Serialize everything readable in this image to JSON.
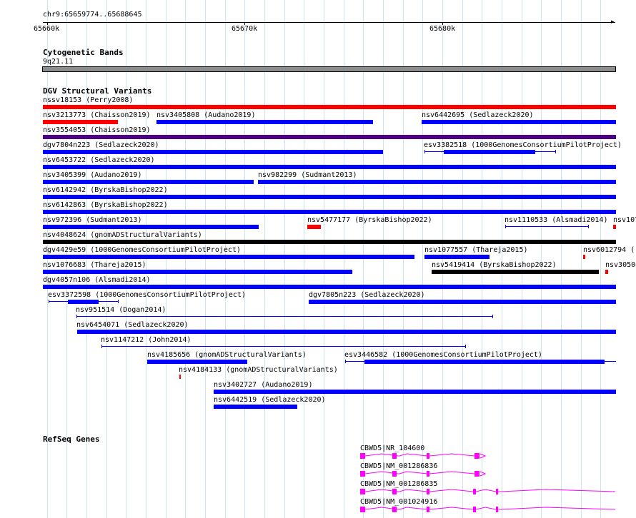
{
  "ruler": {
    "coordinates": "chr9:65659774..65688645",
    "ticks": [
      "65660k",
      "65670k",
      "65680k"
    ]
  },
  "cytoband": {
    "title": "Cytogenetic Bands",
    "band": "9q21.11"
  },
  "dgv": {
    "title": "DGV Structural Variants",
    "variants": [
      "nssv18153 (Perry2008)",
      "nsv3213773 (Chaisson2019)",
      "nsv3405808 (Audano2019)",
      "nsv6442695 (Sedlazeck2020)",
      "nsv3554053 (Chaisson2019)",
      "dgv7804n223 (Sedlazeck2020)",
      "esv3382518 (1000GenomesConsortiumPilotProject)",
      "nsv6453722 (Sedlazeck2020)",
      "nsv3405399 (Audano2019)",
      "nsv982299 (Sudmant2013)",
      "nsv6142942 (ByrskaBishop2022)",
      "nsv6142863 (ByrskaBishop2022)",
      "nsv972396 (Sudmant2013)",
      "nsv5477177 (ByrskaBishop2022)",
      "nsv1110533 (Alsmadi2014)",
      "nsv107",
      "nsv4048624 (gnomADStructuralVariants)",
      "dgv4429e59 (1000GenomesConsortiumPilotProject)",
      "nsv1077557 (Thareja2015)",
      "nsv6012794 (",
      "nsv1076683 (Thareja2015)",
      "nsv5419414 (ByrskaBishop2022)",
      "nsv30508",
      "dgv4057n106 (Alsmadi2014)",
      "esv3372598 (1000GenomesConsortiumPilotProject)",
      "dgv7805n223 (Sedlazeck2020)",
      "nsv951514 (Dogan2014)",
      "nsv6454071 (Sedlazeck2020)",
      "nsv1147212 (John2014)",
      "nsv4185656 (gnomADStructuralVariants)",
      "esv3446582 (1000GenomesConsortiumPilotProject)",
      "nsv4184133 (gnomADStructuralVariants)",
      "nsv3402727 (Audano2019)",
      "nsv6442519 (Sedlazeck2020)"
    ]
  },
  "refseq": {
    "title": "RefSeq Genes",
    "transcripts": [
      "CBWD5|NR_104600",
      "CBWD5|NM_001286836",
      "CBWD5|NM_001286835",
      "CBWD5|NM_001024916"
    ]
  },
  "colors": {
    "gain": "#ff0000",
    "loss": "#0000ff",
    "inversion": "#4b0082",
    "complex": "#000000",
    "gene": "#ff00ff",
    "grid": "#cfe3ef",
    "band": "#8c8c8c"
  }
}
